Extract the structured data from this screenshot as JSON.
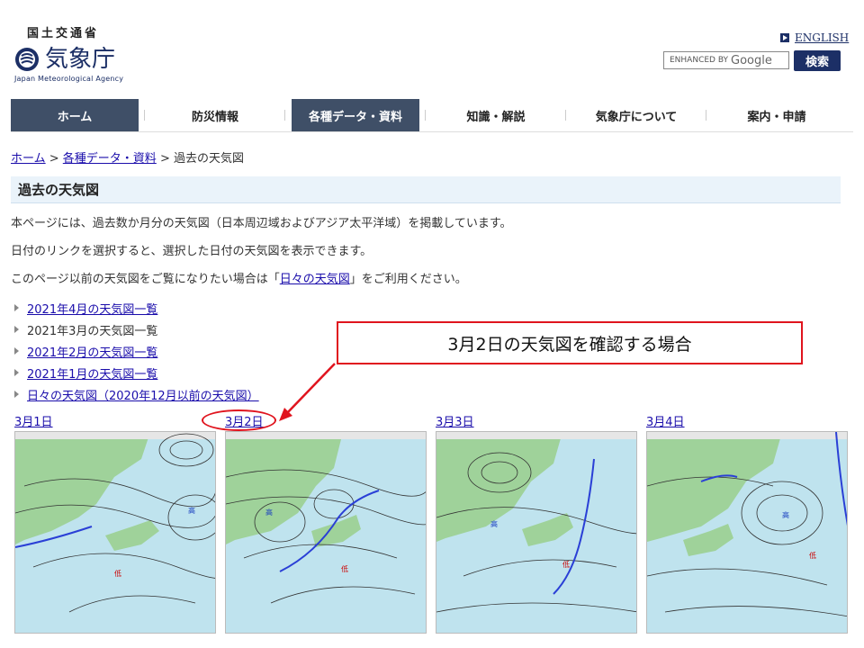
{
  "header": {
    "ministry": "国土交通省",
    "logo_text": "気象庁",
    "logo_en": "Japan Meteorological Agency",
    "english_link": "ENGLISH",
    "search_placeholder": "ENHANCED BY",
    "search_brand": "Google",
    "search_button": "検索"
  },
  "nav": {
    "items": [
      "ホーム",
      "防災情報",
      "各種データ・資料",
      "知識・解説",
      "気象庁について",
      "案内・申請"
    ]
  },
  "breadcrumb": {
    "home": "ホーム",
    "sep1": " > ",
    "data": "各種データ・資料",
    "sep2": " > ",
    "current": "過去の天気図"
  },
  "page_title": "過去の天気図",
  "intro": {
    "line1": "本ページには、過去数か月分の天気図（日本周辺域およびアジア太平洋域）を掲載しています。",
    "line2": "日付のリンクを選択すると、選択した日付の天気図を表示できます。",
    "line3_pre": "このページ以前の天気図をご覧になりたい場合は「",
    "line3_link": "日々の天気図",
    "line3_post": "」をご利用ください。"
  },
  "links": [
    {
      "label": "2021年4月の天気図一覧",
      "is_link": true
    },
    {
      "label": "2021年3月の天気図一覧",
      "is_link": false
    },
    {
      "label": "2021年2月の天気図一覧",
      "is_link": true
    },
    {
      "label": "2021年1月の天気図一覧",
      "is_link": true
    },
    {
      "label": "日々の天気図（2020年12月以前の天気図）",
      "is_link": true
    }
  ],
  "maps": [
    {
      "date": "3月1日"
    },
    {
      "date": "3月2日"
    },
    {
      "date": "3月3日"
    },
    {
      "date": "3月4日"
    }
  ],
  "callout": {
    "text": "3月2日の天気図を確認する場合"
  },
  "colors": {
    "nav_active": "#3f4f67",
    "callout_red": "#e0141e",
    "sea": "#bfe3ee",
    "land": "#9fd29a"
  }
}
